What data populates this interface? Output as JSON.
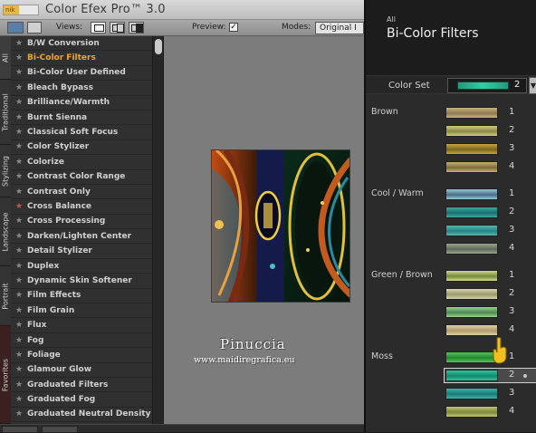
{
  "app": {
    "logo_text": "nik",
    "title": "Color Efex Pro™ 3.0"
  },
  "toolbar": {
    "views_label": "Views:",
    "preview_label": "Preview:",
    "preview_checked": true,
    "preview_check_glyph": "✓",
    "modes_label": "Modes:",
    "modes_value": "Original I"
  },
  "tabs": [
    {
      "label": "All"
    },
    {
      "label": "Traditional"
    },
    {
      "label": "Stylizing"
    },
    {
      "label": "Landscape"
    },
    {
      "label": "Portrait"
    },
    {
      "label": "Favorites"
    }
  ],
  "filters": [
    {
      "label": "B/W Conversion"
    },
    {
      "label": "Bi-Color Filters",
      "selected": true
    },
    {
      "label": "Bi-Color User Defined"
    },
    {
      "label": "Bleach Bypass"
    },
    {
      "label": "Brilliance/Warmth"
    },
    {
      "label": "Burnt Sienna"
    },
    {
      "label": "Classical Soft Focus"
    },
    {
      "label": "Color Stylizer"
    },
    {
      "label": "Colorize"
    },
    {
      "label": "Contrast Color Range"
    },
    {
      "label": "Contrast Only"
    },
    {
      "label": "Cross Balance",
      "favorite": true
    },
    {
      "label": "Cross Processing"
    },
    {
      "label": "Darken/Lighten Center"
    },
    {
      "label": "Detail Stylizer"
    },
    {
      "label": "Duplex"
    },
    {
      "label": "Dynamic Skin Softener"
    },
    {
      "label": "Film Effects"
    },
    {
      "label": "Film Grain"
    },
    {
      "label": "Flux"
    },
    {
      "label": "Fog"
    },
    {
      "label": "Foliage"
    },
    {
      "label": "Glamour Glow"
    },
    {
      "label": "Graduated Filters"
    },
    {
      "label": "Graduated Fog"
    },
    {
      "label": "Graduated Neutral Density"
    }
  ],
  "watermark": {
    "name": "Pinuccia",
    "url": "www.maidiregrafica.eu"
  },
  "panel": {
    "category": "All",
    "title": "Bi-Color Filters",
    "color_set_label": "Color Set",
    "color_set_value": "2",
    "color_set_colors": [
      "#1f9a7e",
      "#2ad1a3"
    ]
  },
  "color_sets": [
    {
      "group": "Brown",
      "items": [
        {
          "num": "1",
          "colors": [
            "#8d7a52",
            "#c8b27e"
          ]
        },
        {
          "num": "2",
          "colors": [
            "#8b8846",
            "#cfcc7c"
          ]
        },
        {
          "num": "3",
          "colors": [
            "#7c6420",
            "#c9a43b"
          ]
        },
        {
          "num": "4",
          "colors": [
            "#7a6c3a",
            "#c9b070"
          ]
        }
      ]
    },
    {
      "group": "Cool / Warm",
      "items": [
        {
          "num": "1",
          "colors": [
            "#466e8a",
            "#9cc6d4"
          ]
        },
        {
          "num": "2",
          "colors": [
            "#1d7070",
            "#3aa9a0"
          ]
        },
        {
          "num": "3",
          "colors": [
            "#2a7f86",
            "#58b6ad"
          ]
        },
        {
          "num": "4",
          "colors": [
            "#5f6a5a",
            "#9aa58e"
          ]
        }
      ]
    },
    {
      "group": "Green / Brown",
      "items": [
        {
          "num": "1",
          "colors": [
            "#6f8b3a",
            "#d6d694"
          ]
        },
        {
          "num": "2",
          "colors": [
            "#9a9a6a",
            "#d9d4ae"
          ]
        },
        {
          "num": "3",
          "colors": [
            "#4a8a50",
            "#9ccf8c"
          ]
        },
        {
          "num": "4",
          "colors": [
            "#b09a6a",
            "#ddd0a8"
          ]
        }
      ]
    },
    {
      "group": "Moss",
      "items": [
        {
          "num": "1",
          "colors": [
            "#1f8a2c",
            "#5ac060"
          ]
        },
        {
          "num": "2",
          "colors": [
            "#12876a",
            "#2fc59d"
          ],
          "selected": true
        },
        {
          "num": "3",
          "colors": [
            "#1a7a78",
            "#3bb5a9"
          ]
        },
        {
          "num": "4",
          "colors": [
            "#7a8a3a",
            "#c3c46e"
          ]
        }
      ]
    }
  ]
}
